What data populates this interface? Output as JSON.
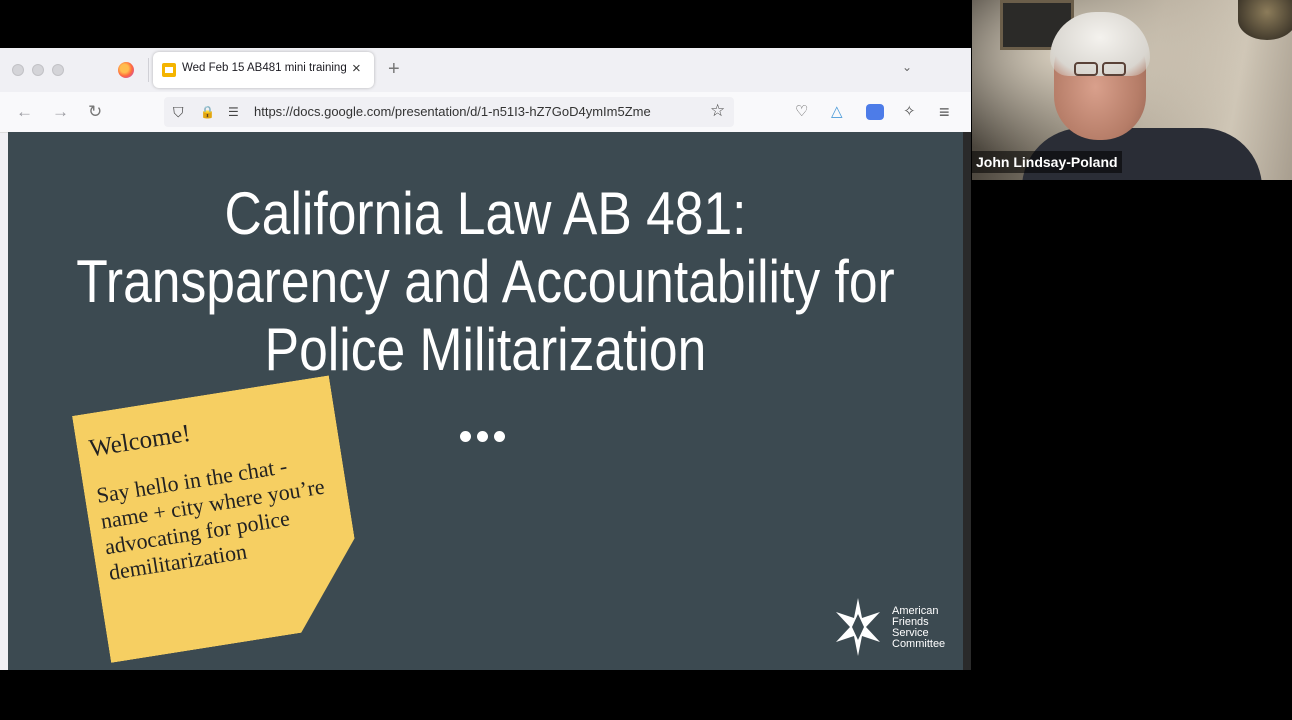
{
  "browser": {
    "tab_title": "Wed Feb 15 AB481 mini training",
    "tab_close": "×",
    "new_tab": "+",
    "url": "https://docs.google.com/presentation/d/1-n51I3-hZ7GoD4ymIm5Zme"
  },
  "icons": {
    "back": "←",
    "forward": "→",
    "reload": "↻",
    "shield": "⛉",
    "lock": "🔒",
    "star": "☆",
    "menu": "≡"
  },
  "slide": {
    "title_lines": [
      "California Law AB 481:",
      "Transparency and Accountability for",
      "Police Militarization"
    ],
    "sticky_welcome": "Welcome!",
    "sticky_body": "Say hello in the chat - name + city where you’re advocating for police demilitarization",
    "logo_lines": [
      "American",
      "Friends",
      "Service",
      "Committee"
    ]
  },
  "video": {
    "participant_name": "John Lindsay-Poland"
  },
  "colors": {
    "slide_bg": "#3c4a51",
    "sticky": "#f6cf62",
    "slides_icon": "#f4b400"
  }
}
